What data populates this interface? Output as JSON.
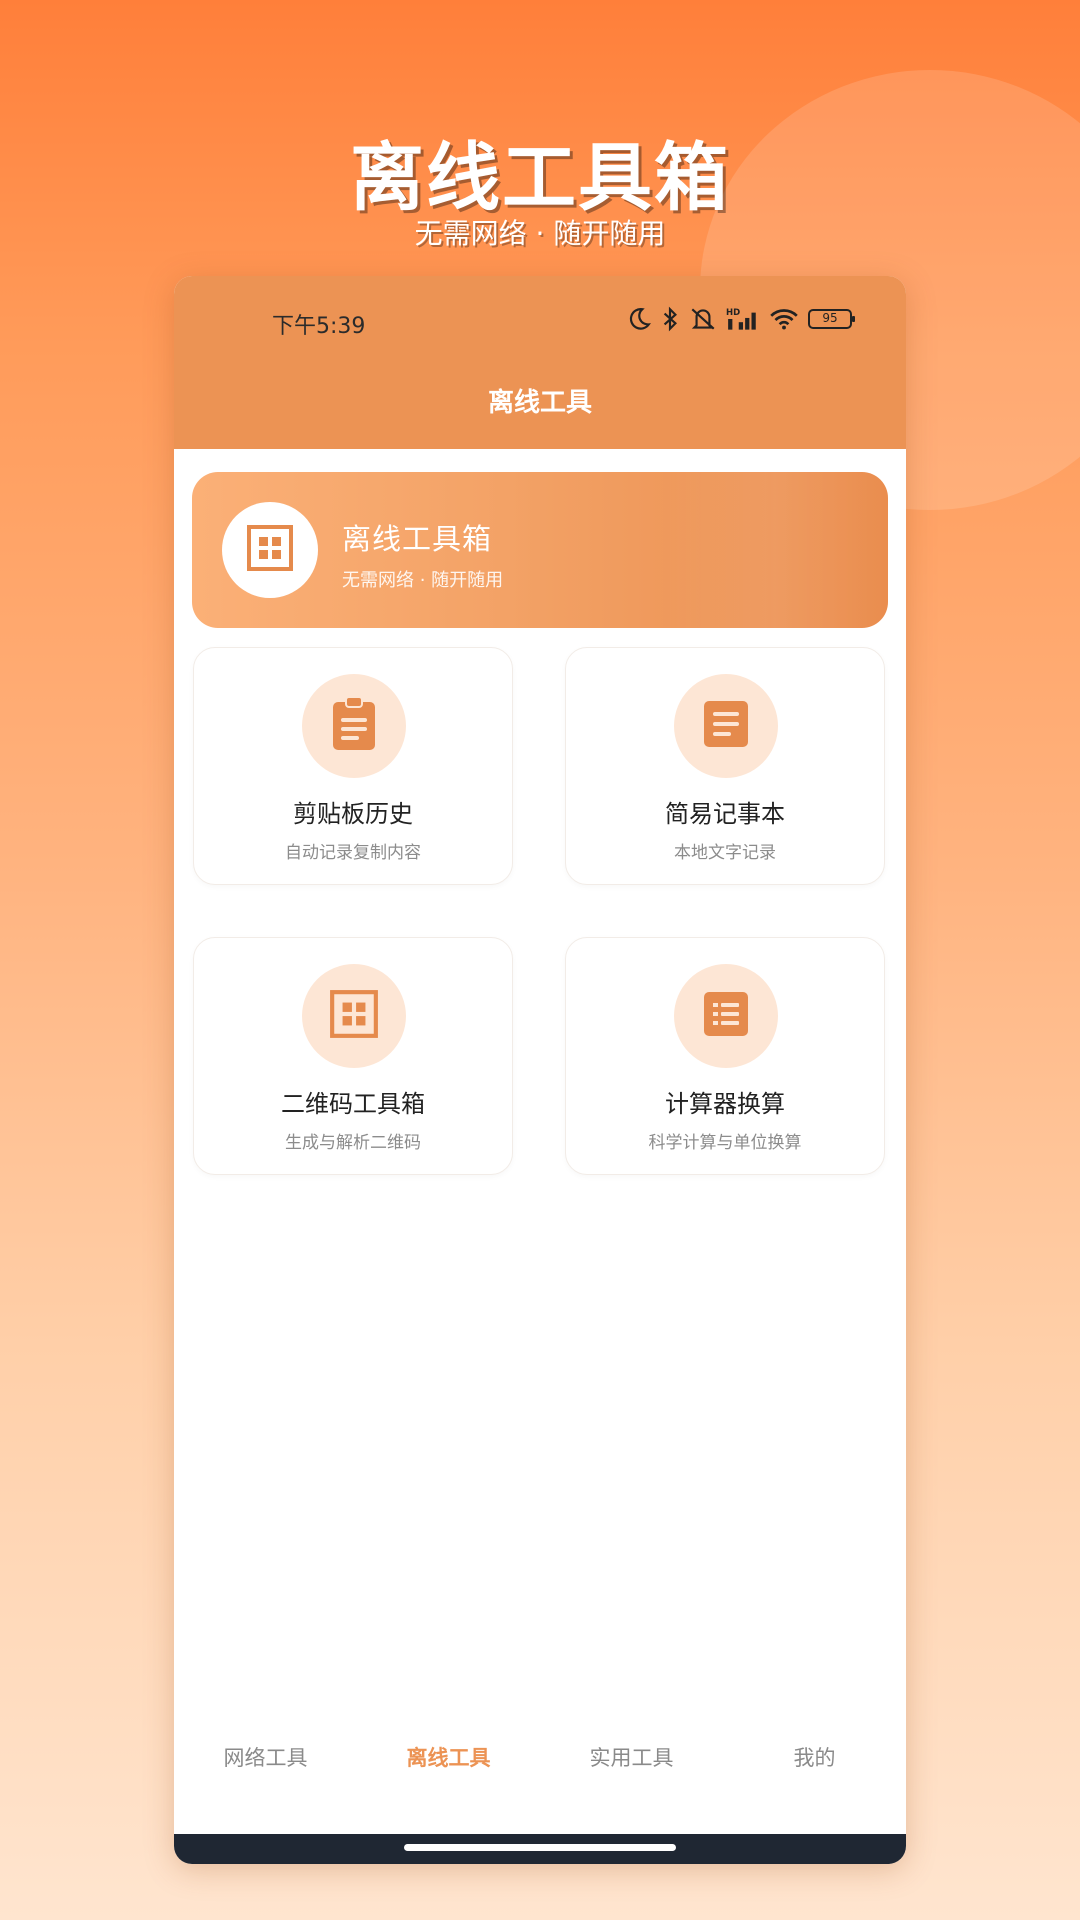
{
  "hero": {
    "title": "离线工具箱",
    "subtitle": "无需网络 · 随开随用"
  },
  "status_bar": {
    "time": "下午5:39",
    "battery": "95",
    "icons": [
      "moon-icon",
      "bluetooth-icon",
      "mute-icon",
      "signal-icon",
      "wifi-icon",
      "battery-icon"
    ]
  },
  "app_bar": {
    "title": "离线工具"
  },
  "banner": {
    "title": "离线工具箱",
    "subtitle": "无需网络 · 随开随用",
    "icon": "grid-icon"
  },
  "tools": [
    {
      "title": "剪贴板历史",
      "desc": "自动记录复制内容",
      "icon": "clipboard-icon"
    },
    {
      "title": "简易记事本",
      "desc": "本地文字记录",
      "icon": "note-icon"
    },
    {
      "title": "二维码工具箱",
      "desc": "生成与解析二维码",
      "icon": "qrcode-icon"
    },
    {
      "title": "计算器换算",
      "desc": "科学计算与单位换算",
      "icon": "calculator-icon"
    }
  ],
  "bottom_nav": {
    "items": [
      {
        "label": "网络工具"
      },
      {
        "label": "离线工具"
      },
      {
        "label": "实用工具"
      },
      {
        "label": "我的"
      }
    ],
    "active_index": 1
  },
  "colors": {
    "accent": "#ec9354",
    "icon": "#e58a4c",
    "icon_bg": "#fde6d5"
  }
}
